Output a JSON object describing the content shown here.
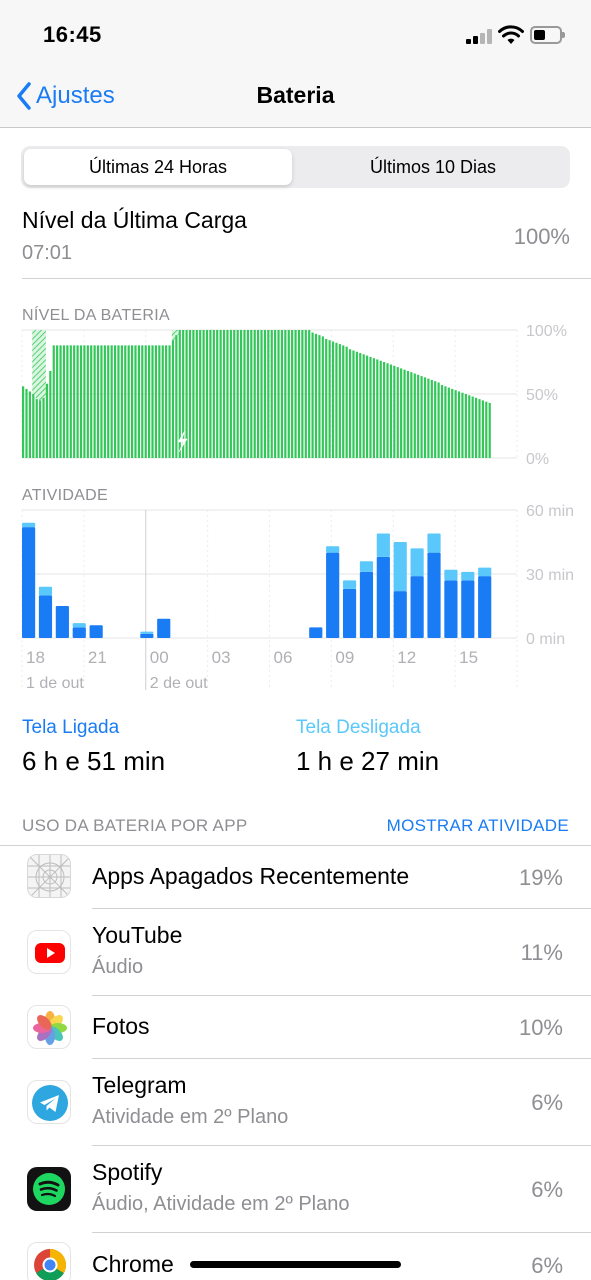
{
  "status_bar": {
    "time": "16:45"
  },
  "nav": {
    "back_label": "Ajustes",
    "title": "Bateria"
  },
  "segments": {
    "left": "Últimas 24 Horas",
    "right": "Últimos 10 Dias",
    "selected": "Últimas 24 Horas"
  },
  "last_charge": {
    "title": "Nível da Última Carga",
    "time": "07:01",
    "percent": "100%"
  },
  "battery_level_label": "NÍVEL DA BATERIA",
  "activity_label": "ATIVIDADE",
  "screen": {
    "on_label": "Tela Ligada",
    "on_value": "6 h e 51 min",
    "off_label": "Tela Desligada",
    "off_value": "1 h e 27 min"
  },
  "usage": {
    "header": "USO DA BATERIA POR APP",
    "action": "MOSTRAR ATIVIDADE"
  },
  "apps": [
    {
      "name": "Apps Apagados Recentemente",
      "subtitle": "",
      "percent": "19%",
      "icon": "deleted-apps-icon"
    },
    {
      "name": "YouTube",
      "subtitle": "Áudio",
      "percent": "11%",
      "icon": "youtube-icon"
    },
    {
      "name": "Fotos",
      "subtitle": "",
      "percent": "10%",
      "icon": "photos-icon"
    },
    {
      "name": "Telegram",
      "subtitle": "Atividade em 2º Plano",
      "percent": "6%",
      "icon": "telegram-icon"
    },
    {
      "name": "Spotify",
      "subtitle": "Áudio, Atividade em 2º Plano",
      "percent": "6%",
      "icon": "spotify-icon"
    },
    {
      "name": "Chrome",
      "subtitle": "",
      "percent": "6%",
      "icon": "chrome-icon"
    }
  ],
  "colors": {
    "accent": "#1a7cf5",
    "battery_green": "#33c759",
    "screen_on": "#1a7cf5",
    "screen_off": "#5ac8fa",
    "secondary_text": "#8e8e93"
  },
  "chart_data": [
    {
      "type": "bar",
      "name": "battery_level",
      "y_ticks": [
        "100%",
        "50%",
        "0%"
      ],
      "ylim": [
        0,
        100
      ],
      "charging_icon_at_bar": 47,
      "charging_hatched_ranges": [
        [
          3,
          6
        ],
        [
          44,
          48
        ]
      ],
      "values": [
        56,
        54,
        52,
        50,
        46,
        45,
        47,
        58,
        68,
        88,
        88,
        88,
        88,
        88,
        88,
        88,
        88,
        88,
        88,
        88,
        88,
        88,
        88,
        88,
        88,
        88,
        88,
        88,
        88,
        88,
        88,
        88,
        88,
        88,
        88,
        88,
        88,
        88,
        88,
        88,
        88,
        88,
        88,
        88,
        92,
        96,
        100,
        100,
        100,
        100,
        100,
        100,
        100,
        100,
        100,
        100,
        100,
        100,
        100,
        100,
        100,
        100,
        100,
        100,
        100,
        100,
        100,
        100,
        100,
        100,
        100,
        100,
        100,
        100,
        100,
        100,
        100,
        100,
        100,
        100,
        100,
        100,
        100,
        100,
        100,
        98,
        97,
        96,
        95,
        93,
        92,
        91,
        90,
        89,
        88,
        87,
        85,
        84,
        83,
        82,
        81,
        80,
        79,
        78,
        77,
        76,
        75,
        74,
        73,
        72,
        71,
        70,
        69,
        68,
        67,
        66,
        65,
        64,
        63,
        62,
        61,
        60,
        59,
        57,
        56,
        55,
        54,
        53,
        52,
        51,
        50,
        49,
        48,
        47,
        46,
        45,
        44,
        43
      ]
    },
    {
      "type": "bar",
      "name": "activity",
      "stacked": true,
      "y_ticks": [
        "60 min",
        "30 min",
        "0 min"
      ],
      "ylim": [
        0,
        60
      ],
      "x_tick_labels": [
        "18",
        "21",
        "00",
        "03",
        "06",
        "09",
        "12",
        "15"
      ],
      "date_labels": [
        "1 de out",
        "2 de out"
      ],
      "series": [
        {
          "name": "Tela Ligada",
          "values": [
            52,
            20,
            15,
            5,
            6,
            0,
            0,
            2,
            9,
            0,
            0,
            0,
            0,
            0,
            0,
            0,
            0,
            5,
            40,
            23,
            31,
            38,
            22,
            29,
            40,
            27,
            27,
            29
          ]
        },
        {
          "name": "Tela Desligada",
          "values": [
            2,
            4,
            0,
            2,
            0,
            0,
            0,
            1,
            0,
            0,
            0,
            0,
            0,
            0,
            0,
            0,
            0,
            0,
            3,
            4,
            5,
            11,
            23,
            13,
            9,
            5,
            4,
            4
          ]
        }
      ]
    }
  ]
}
